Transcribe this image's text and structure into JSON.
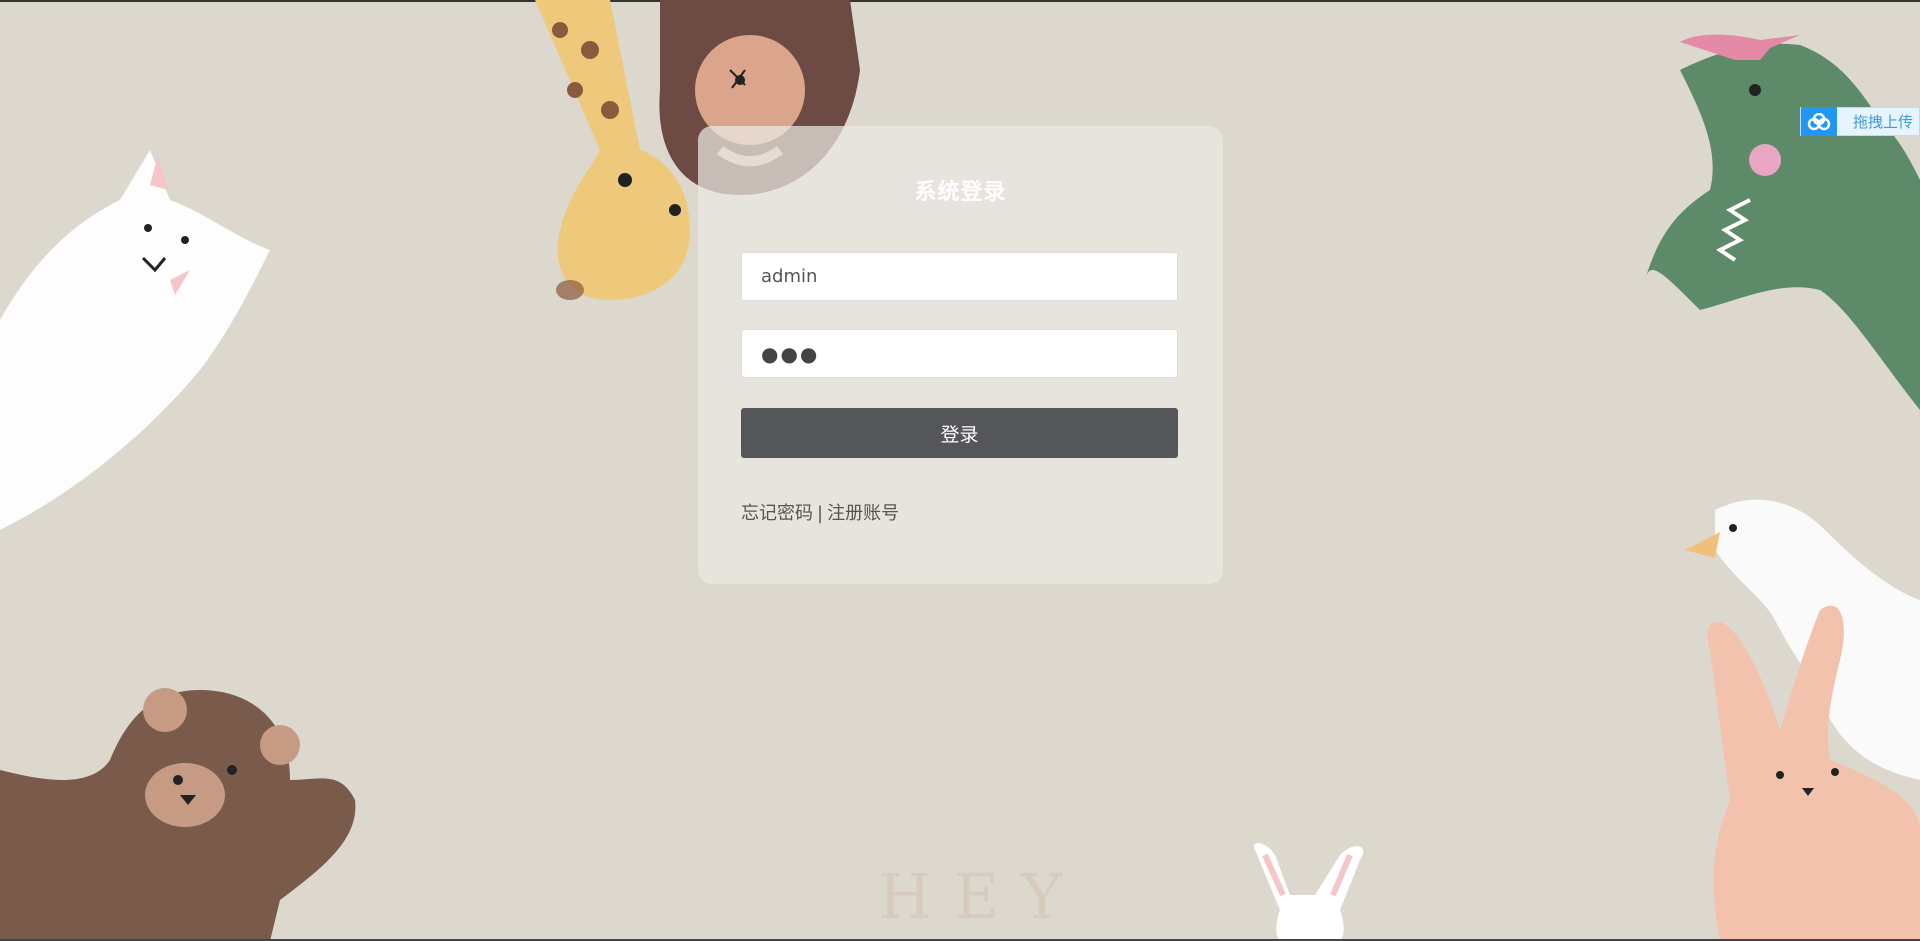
{
  "login": {
    "title": "系统登录",
    "username_value": "admin",
    "password_mask": "●●●",
    "submit_label": "登录",
    "forgot_label": "忘记密码",
    "separator": "|",
    "register_label": "注册账号"
  },
  "background": {
    "hey_text": "HEY"
  },
  "upload_widget": {
    "label": "拖拽上传",
    "icon": "cloud-icon"
  },
  "colors": {
    "background": "#dcd8ce",
    "button": "#54565a",
    "upload_accent": "#2196f3"
  }
}
